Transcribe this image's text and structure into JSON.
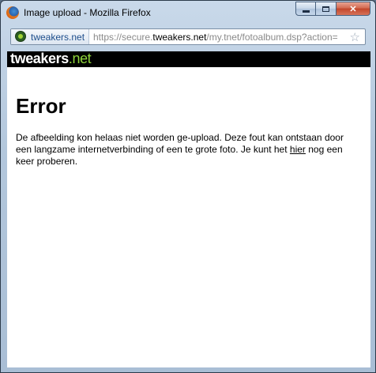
{
  "window": {
    "title": "Image upload - Mozilla Firefox",
    "icon": "firefox-icon",
    "controls": {
      "minimize": "minimize-icon",
      "maximize": "maximize-icon",
      "close": "close-icon"
    }
  },
  "urlbar": {
    "site_identity": "tweakers.net",
    "site_icon": "tweakers-favicon",
    "url_scheme": "https://secure.",
    "url_domain": "tweakers.net",
    "url_path": "/my.tnet/fotoalbum.dsp?action=",
    "bookmark_icon": "star-icon"
  },
  "banner": {
    "logo_main": "tweakers",
    "logo_suffix": ".net",
    "colors": {
      "background": "#000000",
      "accent": "#8fd43a"
    }
  },
  "page": {
    "heading": "Error",
    "message_part1": "De afbeelding kon helaas niet worden ge-upload. Deze fout kan ontstaan door een langzame internetverbinding of een te grote foto. Je kunt het ",
    "message_link": "hier",
    "message_part2": " nog een keer proberen."
  }
}
